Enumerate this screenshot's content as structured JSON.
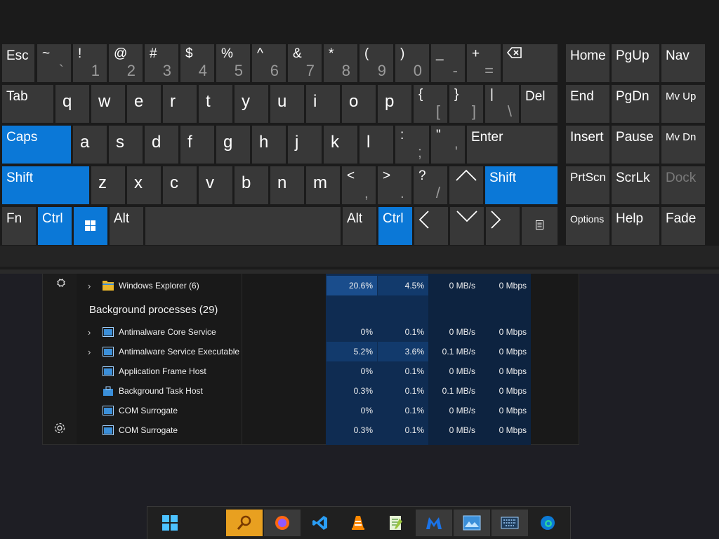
{
  "keyboard": {
    "row1": [
      {
        "label": "Esc"
      },
      {
        "top": "~",
        "bottom": "`"
      },
      {
        "top": "!",
        "bottom": "1"
      },
      {
        "top": "@",
        "bottom": "2"
      },
      {
        "top": "#",
        "bottom": "3"
      },
      {
        "top": "$",
        "bottom": "4"
      },
      {
        "top": "%",
        "bottom": "5"
      },
      {
        "top": "^",
        "bottom": "6"
      },
      {
        "top": "&",
        "bottom": "7"
      },
      {
        "top": "*",
        "bottom": "8"
      },
      {
        "top": "(",
        "bottom": "9"
      },
      {
        "top": ")",
        "bottom": "0"
      },
      {
        "top": "_",
        "bottom": "-"
      },
      {
        "top": "+",
        "bottom": "="
      }
    ],
    "row2": [
      {
        "label": "Tab"
      },
      {
        "letter": "q"
      },
      {
        "letter": "w"
      },
      {
        "letter": "e"
      },
      {
        "letter": "r"
      },
      {
        "letter": "t"
      },
      {
        "letter": "y"
      },
      {
        "letter": "u"
      },
      {
        "letter": "i"
      },
      {
        "letter": "o"
      },
      {
        "letter": "p"
      },
      {
        "top": "{",
        "bottom": "["
      },
      {
        "top": "}",
        "bottom": "]"
      },
      {
        "top": "|",
        "bottom": "\\"
      },
      {
        "label": "Del"
      }
    ],
    "row3": [
      {
        "label": "Caps"
      },
      {
        "letter": "a"
      },
      {
        "letter": "s"
      },
      {
        "letter": "d"
      },
      {
        "letter": "f"
      },
      {
        "letter": "g"
      },
      {
        "letter": "h"
      },
      {
        "letter": "j"
      },
      {
        "letter": "k"
      },
      {
        "letter": "l"
      },
      {
        "top": ":",
        "bottom": ";"
      },
      {
        "top": "\"",
        "bottom": "'"
      },
      {
        "label": "Enter"
      }
    ],
    "row4": [
      {
        "label": "Shift"
      },
      {
        "letter": "z"
      },
      {
        "letter": "x"
      },
      {
        "letter": "c"
      },
      {
        "letter": "v"
      },
      {
        "letter": "b"
      },
      {
        "letter": "n"
      },
      {
        "letter": "m"
      },
      {
        "top": "<",
        "bottom": ","
      },
      {
        "top": ">",
        "bottom": "."
      },
      {
        "top": "?",
        "bottom": "/"
      },
      {
        "label": "Shift"
      }
    ],
    "row5": [
      {
        "label": "Fn"
      },
      {
        "label": "Ctrl"
      },
      {
        "label": "Alt"
      },
      {
        "label": "Alt"
      },
      {
        "label": "Ctrl"
      }
    ],
    "nav": [
      {
        "label": "Home"
      },
      {
        "label": "PgUp"
      },
      {
        "label": "Nav"
      },
      {
        "label": "End"
      },
      {
        "label": "PgDn"
      },
      {
        "label": "Mv Up"
      },
      {
        "label": "Insert"
      },
      {
        "label": "Pause"
      },
      {
        "label": "Mv Dn"
      },
      {
        "label": "PrtScn"
      },
      {
        "label": "ScrLk"
      },
      {
        "label": "Dock"
      },
      {
        "label": "Options"
      },
      {
        "label": "Help"
      },
      {
        "label": "Fade"
      }
    ]
  },
  "task_manager": {
    "top_row": {
      "name": "Windows Explorer (6)",
      "cpu": "20.6%",
      "memory": "4.5%",
      "disk": "0 MB/s",
      "network": "0 Mbps"
    },
    "section_title": "Background processes (29)",
    "processes": [
      {
        "name": "Antimalware Core Service",
        "cpu": "0%",
        "memory": "0.1%",
        "disk": "0 MB/s",
        "network": "0 Mbps",
        "expandable": true
      },
      {
        "name": "Antimalware Service Executable",
        "cpu": "5.2%",
        "memory": "3.6%",
        "disk": "0.1 MB/s",
        "network": "0 Mbps",
        "expandable": true
      },
      {
        "name": "Application Frame Host",
        "cpu": "0%",
        "memory": "0.1%",
        "disk": "0 MB/s",
        "network": "0 Mbps",
        "expandable": false
      },
      {
        "name": "Background Task Host",
        "cpu": "0.3%",
        "memory": "0.1%",
        "disk": "0.1 MB/s",
        "network": "0 Mbps",
        "expandable": false
      },
      {
        "name": "COM Surrogate",
        "cpu": "0%",
        "memory": "0.1%",
        "disk": "0 MB/s",
        "network": "0 Mbps",
        "expandable": false
      },
      {
        "name": "COM Surrogate",
        "cpu": "0.3%",
        "memory": "0.1%",
        "disk": "0 MB/s",
        "network": "0 Mbps",
        "expandable": false
      }
    ]
  },
  "taskbar": {
    "items": [
      "start-icon",
      "search-icon",
      "firefox-icon",
      "vscode-icon",
      "vlc-icon",
      "notepad-plus-icon",
      "malwarebytes-icon",
      "photos-icon",
      "on-screen-keyboard-icon",
      "edge-icon"
    ]
  },
  "colors": {
    "accent": "#0b78d7",
    "key": "#383838",
    "keyboard_bg": "#1b1b1b",
    "heat_dark": "#0e2a4f",
    "heat_mid": "#123a6c",
    "heat_light": "#1a4d8c"
  }
}
